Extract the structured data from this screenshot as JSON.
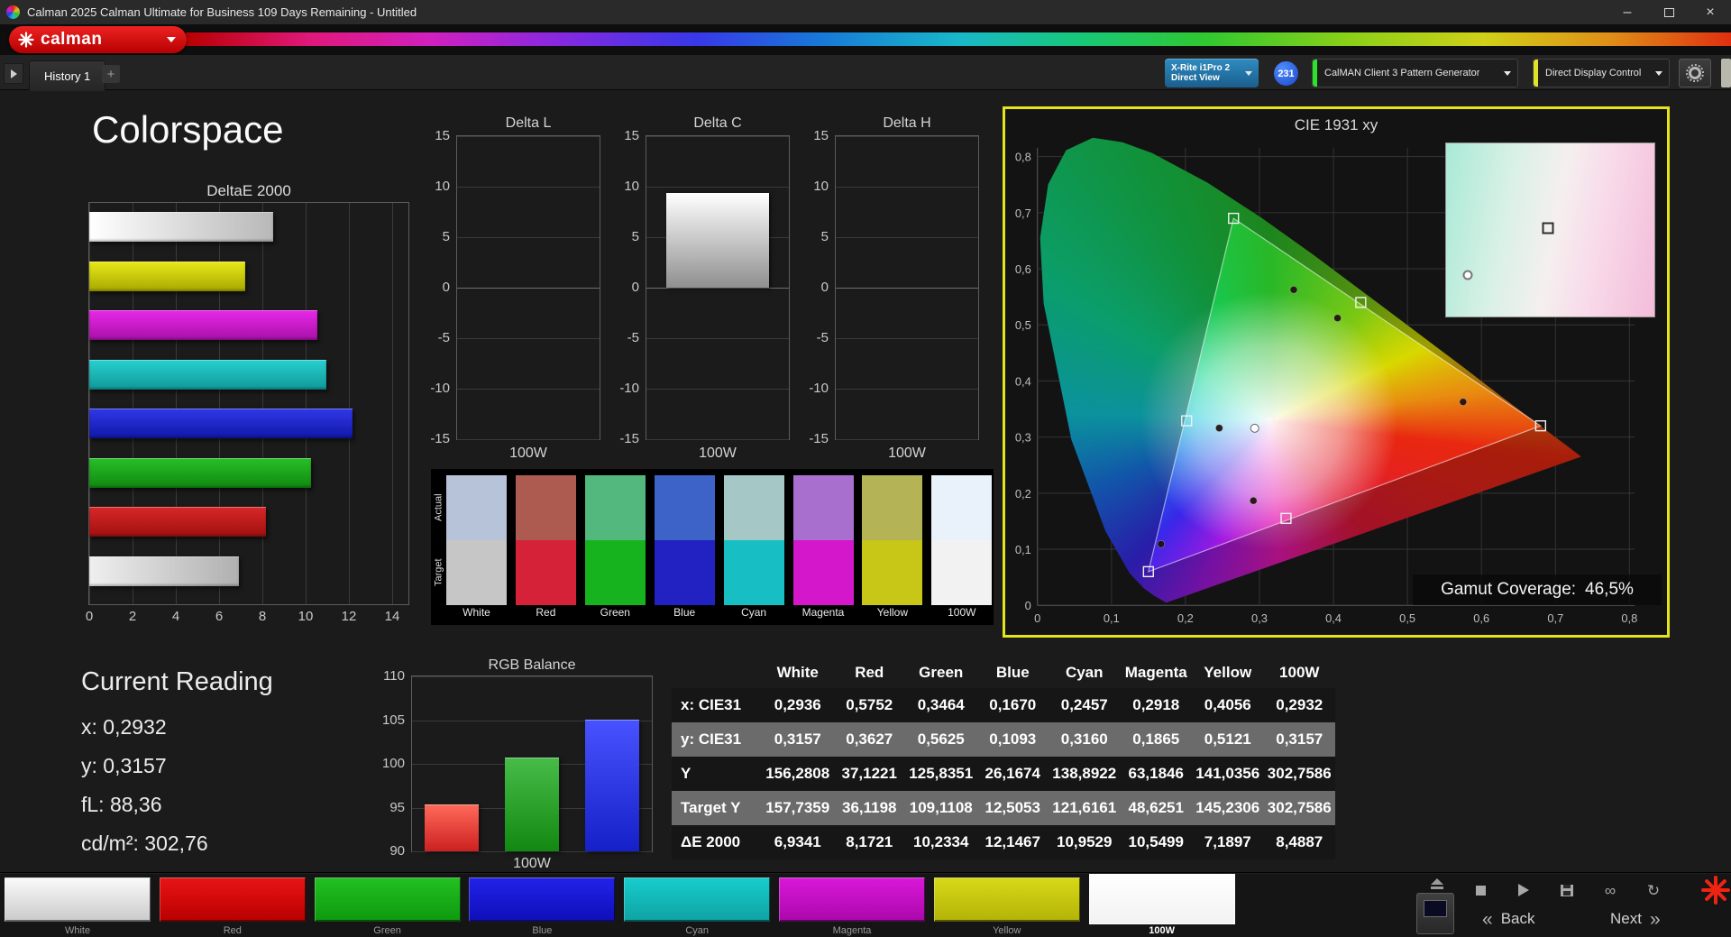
{
  "window": {
    "title": "Calman 2025 Calman Ultimate for Business 109 Days Remaining  - Untitled"
  },
  "brand": {
    "logo_text": "calman"
  },
  "icons": {
    "minimize": "–",
    "close": "×",
    "link": "∞",
    "refresh": "↻",
    "back_chevron": "«",
    "next_chevron": "»"
  },
  "toolbar": {
    "tab_label": "History 1",
    "add_tab_label": "+",
    "meter": {
      "line1": "X-Rite i1Pro 2",
      "line2": "Direct View",
      "badge": "231"
    },
    "pattern_generator_label": "CalMAN Client 3 Pattern Generator",
    "display_control_label": "Direct Display Control"
  },
  "page_title": "Colorspace",
  "current_reading": {
    "title": "Current Reading",
    "lines": [
      "x: 0,2932",
      "y: 0,3157",
      "fL: 88,36",
      "cd/m²: 302,76"
    ]
  },
  "chart_data": [
    {
      "id": "deltae2000",
      "type": "bar",
      "orientation": "horizontal",
      "title": "DeltaE 2000",
      "categories": [
        "100W",
        "Yellow",
        "Magenta",
        "Cyan",
        "Blue",
        "Green",
        "Red",
        "White"
      ],
      "values": [
        8.4887,
        7.1897,
        10.5499,
        10.9529,
        12.1467,
        10.2334,
        8.1721,
        6.9341
      ],
      "bar_colors": [
        {
          "from": "#ffffff",
          "to": "#b8b8b8",
          "angle": 90
        },
        {
          "from": "#e8e818",
          "to": "#a8a800",
          "angle": 180
        },
        {
          "from": "#e828e8",
          "to": "#a810a8",
          "angle": 180
        },
        {
          "from": "#28d0d0",
          "to": "#109898",
          "angle": 180
        },
        {
          "from": "#3038e8",
          "to": "#1018a8",
          "angle": 180
        },
        {
          "from": "#28c028",
          "to": "#108810",
          "angle": 180
        },
        {
          "from": "#d82828",
          "to": "#a01010",
          "angle": 180
        },
        {
          "from": "#efefef",
          "to": "#b0b0b0",
          "angle": 90
        }
      ],
      "xlim": [
        0,
        14
      ],
      "xticks": [
        0,
        2,
        4,
        6,
        8,
        10,
        12,
        14
      ]
    },
    {
      "id": "delta_l",
      "type": "bar",
      "title": "Delta L",
      "categories": [
        "100W"
      ],
      "values": [
        0
      ],
      "baseline": 0,
      "ylim": [
        -15,
        15
      ],
      "yticks": [
        15,
        10,
        5,
        0,
        -5,
        -10,
        -15
      ],
      "xlabel": "100W",
      "bar_colors": [
        {
          "from": "#ffffff",
          "to": "#8f8f8f",
          "angle": 180
        }
      ]
    },
    {
      "id": "delta_c",
      "type": "bar",
      "title": "Delta C",
      "categories": [
        "100W"
      ],
      "values": [
        9.4
      ],
      "baseline": 0,
      "ylim": [
        -15,
        15
      ],
      "yticks": [
        15,
        10,
        5,
        0,
        -5,
        -10,
        -15
      ],
      "xlabel": "100W",
      "bar_colors": [
        {
          "from": "#ffffff",
          "to": "#8f8f8f",
          "angle": 180
        }
      ]
    },
    {
      "id": "delta_h",
      "type": "bar",
      "title": "Delta H",
      "categories": [
        "100W"
      ],
      "values": [
        0
      ],
      "baseline": 0,
      "ylim": [
        -15,
        15
      ],
      "yticks": [
        15,
        10,
        5,
        0,
        -5,
        -10,
        -15
      ],
      "xlabel": "100W",
      "bar_colors": [
        {
          "from": "#ffffff",
          "to": "#8f8f8f",
          "angle": 180
        }
      ]
    },
    {
      "id": "rgb_balance",
      "type": "bar",
      "title": "RGB Balance",
      "categories": [
        "Red",
        "Green",
        "Blue"
      ],
      "values": [
        95.4,
        100.7,
        105.1
      ],
      "baseline": 90,
      "bar_colors": [
        {
          "from": "#ff6a5a",
          "to": "#cc2020",
          "angle": 180
        },
        {
          "from": "#48bc48",
          "to": "#128812",
          "angle": 180
        },
        {
          "from": "#4853ff",
          "to": "#1520c8",
          "angle": 180
        }
      ],
      "ylim": [
        90,
        110
      ],
      "yticks": [
        110,
        105,
        100,
        95,
        90
      ],
      "xlabel": "100W"
    },
    {
      "id": "cie1931",
      "type": "scatter",
      "title": "CIE 1931 xy",
      "xlim": [
        0,
        0.8
      ],
      "ylim": [
        0,
        0.8
      ],
      "xticks": [
        "0",
        "0,1",
        "0,2",
        "0,3",
        "0,4",
        "0,5",
        "0,6",
        "0,7",
        "0,8"
      ],
      "yticks": [
        "0",
        "0,1",
        "0,2",
        "0,3",
        "0,4",
        "0,5",
        "0,6",
        "0,7",
        "0,8"
      ],
      "target_triangle": [
        [
          0.265,
          0.69
        ],
        [
          0.68,
          0.32
        ],
        [
          0.15,
          0.06
        ]
      ],
      "target_points": [
        [
          0.265,
          0.69
        ],
        [
          0.437,
          0.54
        ],
        [
          0.68,
          0.32
        ],
        [
          0.336,
          0.155
        ],
        [
          0.15,
          0.06
        ],
        [
          0.2017,
          0.329
        ],
        [
          0.3127,
          0.329
        ]
      ],
      "measured_points": [
        [
          0.3464,
          0.5625
        ],
        [
          0.4056,
          0.5121
        ],
        [
          0.5752,
          0.3627
        ],
        [
          0.2457,
          0.316
        ],
        [
          0.2918,
          0.1865
        ],
        [
          0.167,
          0.1093
        ]
      ],
      "measured_white": [
        0.2936,
        0.3157
      ],
      "inset": {
        "square": [
          0.49,
          0.49
        ],
        "circle": [
          0.105,
          0.76
        ]
      },
      "gamut_coverage_label": "Gamut Coverage:",
      "gamut_coverage_value": "46,5%"
    }
  ],
  "swatch_panel": {
    "row_labels": [
      "Actual",
      "Target"
    ],
    "columns": [
      {
        "label": "White",
        "actual": "#b7c3d8",
        "target": "#c6c6c6"
      },
      {
        "label": "Red",
        "actual": "#ad5a50",
        "target": "#d62238"
      },
      {
        "label": "Green",
        "actual": "#52b87e",
        "target": "#17b31e"
      },
      {
        "label": "Blue",
        "actual": "#3d63c9",
        "target": "#2222c2"
      },
      {
        "label": "Cyan",
        "actual": "#a5c8c6",
        "target": "#17bfc4"
      },
      {
        "label": "Magenta",
        "actual": "#a96fce",
        "target": "#d517cb"
      },
      {
        "label": "Yellow",
        "actual": "#b4b457",
        "target": "#c8c617"
      },
      {
        "label": "100W",
        "actual": "#e9f1fb",
        "target": "#f2f2f2"
      }
    ]
  },
  "table": {
    "columns": [
      "",
      "White",
      "Red",
      "Green",
      "Blue",
      "Cyan",
      "Magenta",
      "Yellow",
      "100W"
    ],
    "rows": [
      {
        "label": "x: CIE31",
        "values": [
          "0,2936",
          "0,5752",
          "0,3464",
          "0,1670",
          "0,2457",
          "0,2918",
          "0,4056",
          "0,2932"
        ]
      },
      {
        "label": "y: CIE31",
        "values": [
          "0,3157",
          "0,3627",
          "0,5625",
          "0,1093",
          "0,3160",
          "0,1865",
          "0,5121",
          "0,3157"
        ]
      },
      {
        "label": "Y",
        "values": [
          "156,2808",
          "37,1221",
          "125,8351",
          "26,1674",
          "138,8922",
          "63,1846",
          "141,0356",
          "302,7586"
        ]
      },
      {
        "label": "Target Y",
        "values": [
          "157,7359",
          "36,1198",
          "109,1108",
          "12,5053",
          "121,6161",
          "48,6251",
          "145,2306",
          "302,7586"
        ]
      },
      {
        "label": "ΔE 2000",
        "values": [
          "6,9341",
          "8,1721",
          "10,2334",
          "12,1467",
          "10,9529",
          "10,5499",
          "7,1897",
          "8,4887"
        ]
      }
    ]
  },
  "bottom_bar": {
    "patches": [
      {
        "label": "White",
        "from": "#fafafa",
        "to": "#cccccc",
        "selected": false
      },
      {
        "label": "Red",
        "from": "#e81414",
        "to": "#bb0000",
        "selected": false
      },
      {
        "label": "Green",
        "from": "#22c022",
        "to": "#0f9a0f",
        "selected": false
      },
      {
        "label": "Blue",
        "from": "#2222e8",
        "to": "#0f0fbb",
        "selected": false
      },
      {
        "label": "Cyan",
        "from": "#18cccc",
        "to": "#0fa4a4",
        "selected": false
      },
      {
        "label": "Magenta",
        "from": "#d818d8",
        "to": "#ad08ad",
        "selected": false
      },
      {
        "label": "Yellow",
        "from": "#d8d818",
        "to": "#b4b408",
        "selected": false
      },
      {
        "label": "100W",
        "from": "#ffffff",
        "to": "#f2f2f2",
        "selected": true
      }
    ],
    "back_label": "Back",
    "next_label": "Next"
  }
}
